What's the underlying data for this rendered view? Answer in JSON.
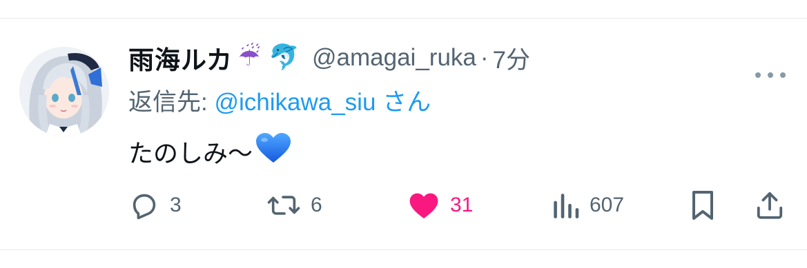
{
  "tweet": {
    "author": {
      "display_name": "雨海ルカ",
      "emoji_1": "☔",
      "emoji_2": "🐬",
      "handle": "@amagai_ruka",
      "separator": "·",
      "time": "7分"
    },
    "reply": {
      "prefix": "返信先: ",
      "target": "@ichikawa_siu",
      "suffix": " さん"
    },
    "text": "たのしみ〜",
    "text_emoji": "💙",
    "actions": {
      "reply_count": "3",
      "retweet_count": "6",
      "like_count": "31",
      "views_count": "607"
    },
    "icons": {
      "reply": "reply-icon",
      "retweet": "retweet-icon",
      "like": "heart-icon",
      "views": "views-icon",
      "bookmark": "bookmark-icon",
      "share": "share-icon",
      "more": "more-icon"
    },
    "colors": {
      "accent": "#1d9bf0",
      "like": "#f91880",
      "secondary_text": "#536471"
    }
  }
}
